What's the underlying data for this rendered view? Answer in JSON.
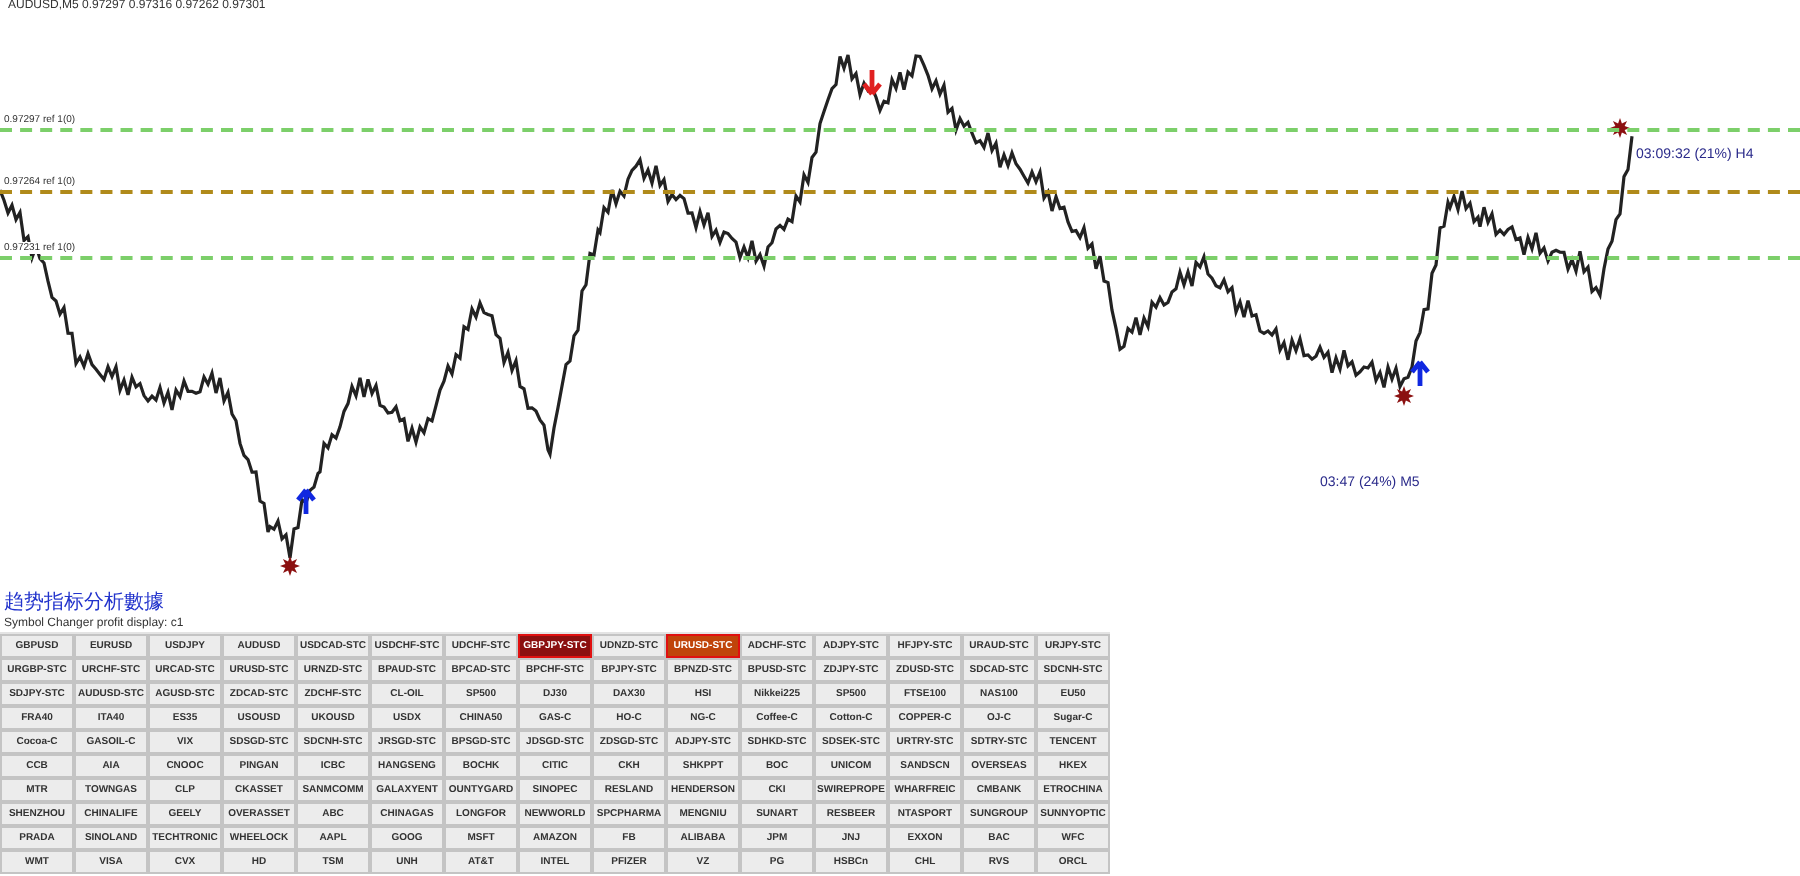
{
  "chart": {
    "title": "AUDUSD,M5  0.97297 0.97316 0.97262 0.97301",
    "levels": [
      {
        "label": "0.97297 ref 1(0)",
        "color": "#7ccf6a"
      },
      {
        "label": "0.97264 ref 1(0)",
        "color": "#b08a1a"
      },
      {
        "label": "0.97231 ref 1(0)",
        "color": "#7ccf6a"
      }
    ],
    "timers": [
      "03:09:32 (21%) H4",
      "03:47 (24%) M5"
    ],
    "note": "趋势指标分析數據"
  },
  "panel_title": "Symbol Changer profit display: c1",
  "symbols": [
    [
      {
        "label": "GBPUSD",
        "selected": false
      },
      {
        "label": "EURUSD",
        "selected": false
      },
      {
        "label": "USDJPY",
        "selected": false
      },
      {
        "label": "AUDUSD",
        "selected": false
      },
      {
        "label": "USDCAD-STC",
        "selected": false
      },
      {
        "label": "USDCHF-STC",
        "selected": false
      },
      {
        "label": "UDCHF-STC",
        "selected": false
      },
      {
        "label": "GBPJPY-STC",
        "selected": true,
        "color": "#8b0f0f"
      },
      {
        "label": "UDNZD-STC",
        "selected": false
      },
      {
        "label": "URUSD-STC",
        "selected": true,
        "color": "#c0440a"
      },
      {
        "label": "ADCHF-STC",
        "selected": false
      },
      {
        "label": "ADJPY-STC",
        "selected": false
      },
      {
        "label": "HFJPY-STC",
        "selected": false
      },
      {
        "label": "URAUD-STC",
        "selected": false
      },
      {
        "label": "URJPY-STC",
        "selected": false
      }
    ],
    [
      {
        "label": "URGBP-STC",
        "selected": false
      },
      {
        "label": "URCHF-STC",
        "selected": false
      },
      {
        "label": "URCAD-STC",
        "selected": false
      },
      {
        "label": "URUSD-STC",
        "selected": false
      },
      {
        "label": "URNZD-STC",
        "selected": false
      },
      {
        "label": "BPAUD-STC",
        "selected": false
      },
      {
        "label": "BPCAD-STC",
        "selected": false
      },
      {
        "label": "BPCHF-STC",
        "selected": false
      },
      {
        "label": "BPJPY-STC",
        "selected": false
      },
      {
        "label": "BPNZD-STC",
        "selected": false
      },
      {
        "label": "BPUSD-STC",
        "selected": false
      },
      {
        "label": "ZDJPY-STC",
        "selected": false
      },
      {
        "label": "ZDUSD-STC",
        "selected": false
      },
      {
        "label": "SDCAD-STC",
        "selected": false
      },
      {
        "label": "SDCNH-STC",
        "selected": false
      }
    ],
    [
      {
        "label": "SDJPY-STC",
        "selected": false
      },
      {
        "label": "AUDUSD-STC",
        "selected": false
      },
      {
        "label": "AGUSD-STC",
        "selected": false
      },
      {
        "label": "ZDCAD-STC",
        "selected": false
      },
      {
        "label": "ZDCHF-STC",
        "selected": false
      },
      {
        "label": "CL-OIL",
        "selected": false
      },
      {
        "label": "SP500",
        "selected": false
      },
      {
        "label": "DJ30",
        "selected": false
      },
      {
        "label": "DAX30",
        "selected": false
      },
      {
        "label": "HSI",
        "selected": false
      },
      {
        "label": "Nikkei225",
        "selected": false
      },
      {
        "label": "SP500",
        "selected": false
      },
      {
        "label": "FTSE100",
        "selected": false
      },
      {
        "label": "NAS100",
        "selected": false
      },
      {
        "label": "EU50",
        "selected": false
      }
    ],
    [
      {
        "label": "FRA40",
        "selected": false
      },
      {
        "label": "ITA40",
        "selected": false
      },
      {
        "label": "ES35",
        "selected": false
      },
      {
        "label": "USOUSD",
        "selected": false
      },
      {
        "label": "UKOUSD",
        "selected": false
      },
      {
        "label": "USDX",
        "selected": false
      },
      {
        "label": "CHINA50",
        "selected": false
      },
      {
        "label": "GAS-C",
        "selected": false
      },
      {
        "label": "HO-C",
        "selected": false
      },
      {
        "label": "NG-C",
        "selected": false
      },
      {
        "label": "Coffee-C",
        "selected": false
      },
      {
        "label": "Cotton-C",
        "selected": false
      },
      {
        "label": "COPPER-C",
        "selected": false
      },
      {
        "label": "OJ-C",
        "selected": false
      },
      {
        "label": "Sugar-C",
        "selected": false
      }
    ],
    [
      {
        "label": "Cocoa-C",
        "selected": false
      },
      {
        "label": "GASOIL-C",
        "selected": false
      },
      {
        "label": "VIX",
        "selected": false
      },
      {
        "label": "SDSGD-STC",
        "selected": false
      },
      {
        "label": "SDCNH-STC",
        "selected": false
      },
      {
        "label": "JRSGD-STC",
        "selected": false
      },
      {
        "label": "BPSGD-STC",
        "selected": false
      },
      {
        "label": "JDSGD-STC",
        "selected": false
      },
      {
        "label": "ZDSGD-STC",
        "selected": false
      },
      {
        "label": "ADJPY-STC",
        "selected": false
      },
      {
        "label": "SDHKD-STC",
        "selected": false
      },
      {
        "label": "SDSEK-STC",
        "selected": false
      },
      {
        "label": "URTRY-STC",
        "selected": false
      },
      {
        "label": "SDTRY-STC",
        "selected": false
      },
      {
        "label": "TENCENT",
        "selected": false
      }
    ],
    [
      {
        "label": "CCB",
        "selected": false
      },
      {
        "label": "AIA",
        "selected": false
      },
      {
        "label": "CNOOC",
        "selected": false
      },
      {
        "label": "PINGAN",
        "selected": false
      },
      {
        "label": "ICBC",
        "selected": false
      },
      {
        "label": "HANGSENG",
        "selected": false
      },
      {
        "label": "BOCHK",
        "selected": false
      },
      {
        "label": "CITIC",
        "selected": false
      },
      {
        "label": "CKH",
        "selected": false
      },
      {
        "label": "SHKPPT",
        "selected": false
      },
      {
        "label": "BOC",
        "selected": false
      },
      {
        "label": "UNICOM",
        "selected": false
      },
      {
        "label": "SANDSCN",
        "selected": false
      },
      {
        "label": "OVERSEAS",
        "selected": false
      },
      {
        "label": "HKEX",
        "selected": false
      }
    ],
    [
      {
        "label": "MTR",
        "selected": false
      },
      {
        "label": "TOWNGAS",
        "selected": false
      },
      {
        "label": "CLP",
        "selected": false
      },
      {
        "label": "CKASSET",
        "selected": false
      },
      {
        "label": "SANMCOMM",
        "selected": false
      },
      {
        "label": "GALAXYENT",
        "selected": false
      },
      {
        "label": "OUNTYGARD",
        "selected": false
      },
      {
        "label": "SINOPEC",
        "selected": false
      },
      {
        "label": "RESLAND",
        "selected": false
      },
      {
        "label": "HENDERSON",
        "selected": false
      },
      {
        "label": "CKI",
        "selected": false
      },
      {
        "label": "SWIREPROPE",
        "selected": false
      },
      {
        "label": "WHARFREIC",
        "selected": false
      },
      {
        "label": "CMBANK",
        "selected": false
      },
      {
        "label": "ETROCHINA",
        "selected": false
      }
    ],
    [
      {
        "label": "SHENZHOU",
        "selected": false
      },
      {
        "label": "CHINALIFE",
        "selected": false
      },
      {
        "label": "GEELY",
        "selected": false
      },
      {
        "label": "OVERASSET",
        "selected": false
      },
      {
        "label": "ABC",
        "selected": false
      },
      {
        "label": "CHINAGAS",
        "selected": false
      },
      {
        "label": "LONGFOR",
        "selected": false
      },
      {
        "label": "NEWWORLD",
        "selected": false
      },
      {
        "label": "SPCPHARMA",
        "selected": false
      },
      {
        "label": "MENGNIU",
        "selected": false
      },
      {
        "label": "SUNART",
        "selected": false
      },
      {
        "label": "RESBEER",
        "selected": false
      },
      {
        "label": "NTASPORT",
        "selected": false
      },
      {
        "label": "SUNGROUP",
        "selected": false
      },
      {
        "label": "SUNNYOPTIC",
        "selected": false
      }
    ],
    [
      {
        "label": "PRADA",
        "selected": false
      },
      {
        "label": "SINOLAND",
        "selected": false
      },
      {
        "label": "TECHTRONIC",
        "selected": false
      },
      {
        "label": "WHEELOCK",
        "selected": false
      },
      {
        "label": "AAPL",
        "selected": false
      },
      {
        "label": "GOOG",
        "selected": false
      },
      {
        "label": "MSFT",
        "selected": false
      },
      {
        "label": "AMAZON",
        "selected": false
      },
      {
        "label": "FB",
        "selected": false
      },
      {
        "label": "ALIBABA",
        "selected": false
      },
      {
        "label": "JPM",
        "selected": false
      },
      {
        "label": "JNJ",
        "selected": false
      },
      {
        "label": "EXXON",
        "selected": false
      },
      {
        "label": "BAC",
        "selected": false
      },
      {
        "label": "WFC",
        "selected": false
      }
    ],
    [
      {
        "label": "WMT",
        "selected": false
      },
      {
        "label": "VISA",
        "selected": false
      },
      {
        "label": "CVX",
        "selected": false
      },
      {
        "label": "HD",
        "selected": false
      },
      {
        "label": "TSM",
        "selected": false
      },
      {
        "label": "UNH",
        "selected": false
      },
      {
        "label": "AT&T",
        "selected": false
      },
      {
        "label": "INTEL",
        "selected": false
      },
      {
        "label": "PFIZER",
        "selected": false
      },
      {
        "label": "VZ",
        "selected": false
      },
      {
        "label": "PG",
        "selected": false
      },
      {
        "label": "HSBCn",
        "selected": false
      },
      {
        "label": "CHL",
        "selected": false
      },
      {
        "label": "RVS",
        "selected": false
      },
      {
        "label": "ORCL",
        "selected": false
      }
    ]
  ]
}
